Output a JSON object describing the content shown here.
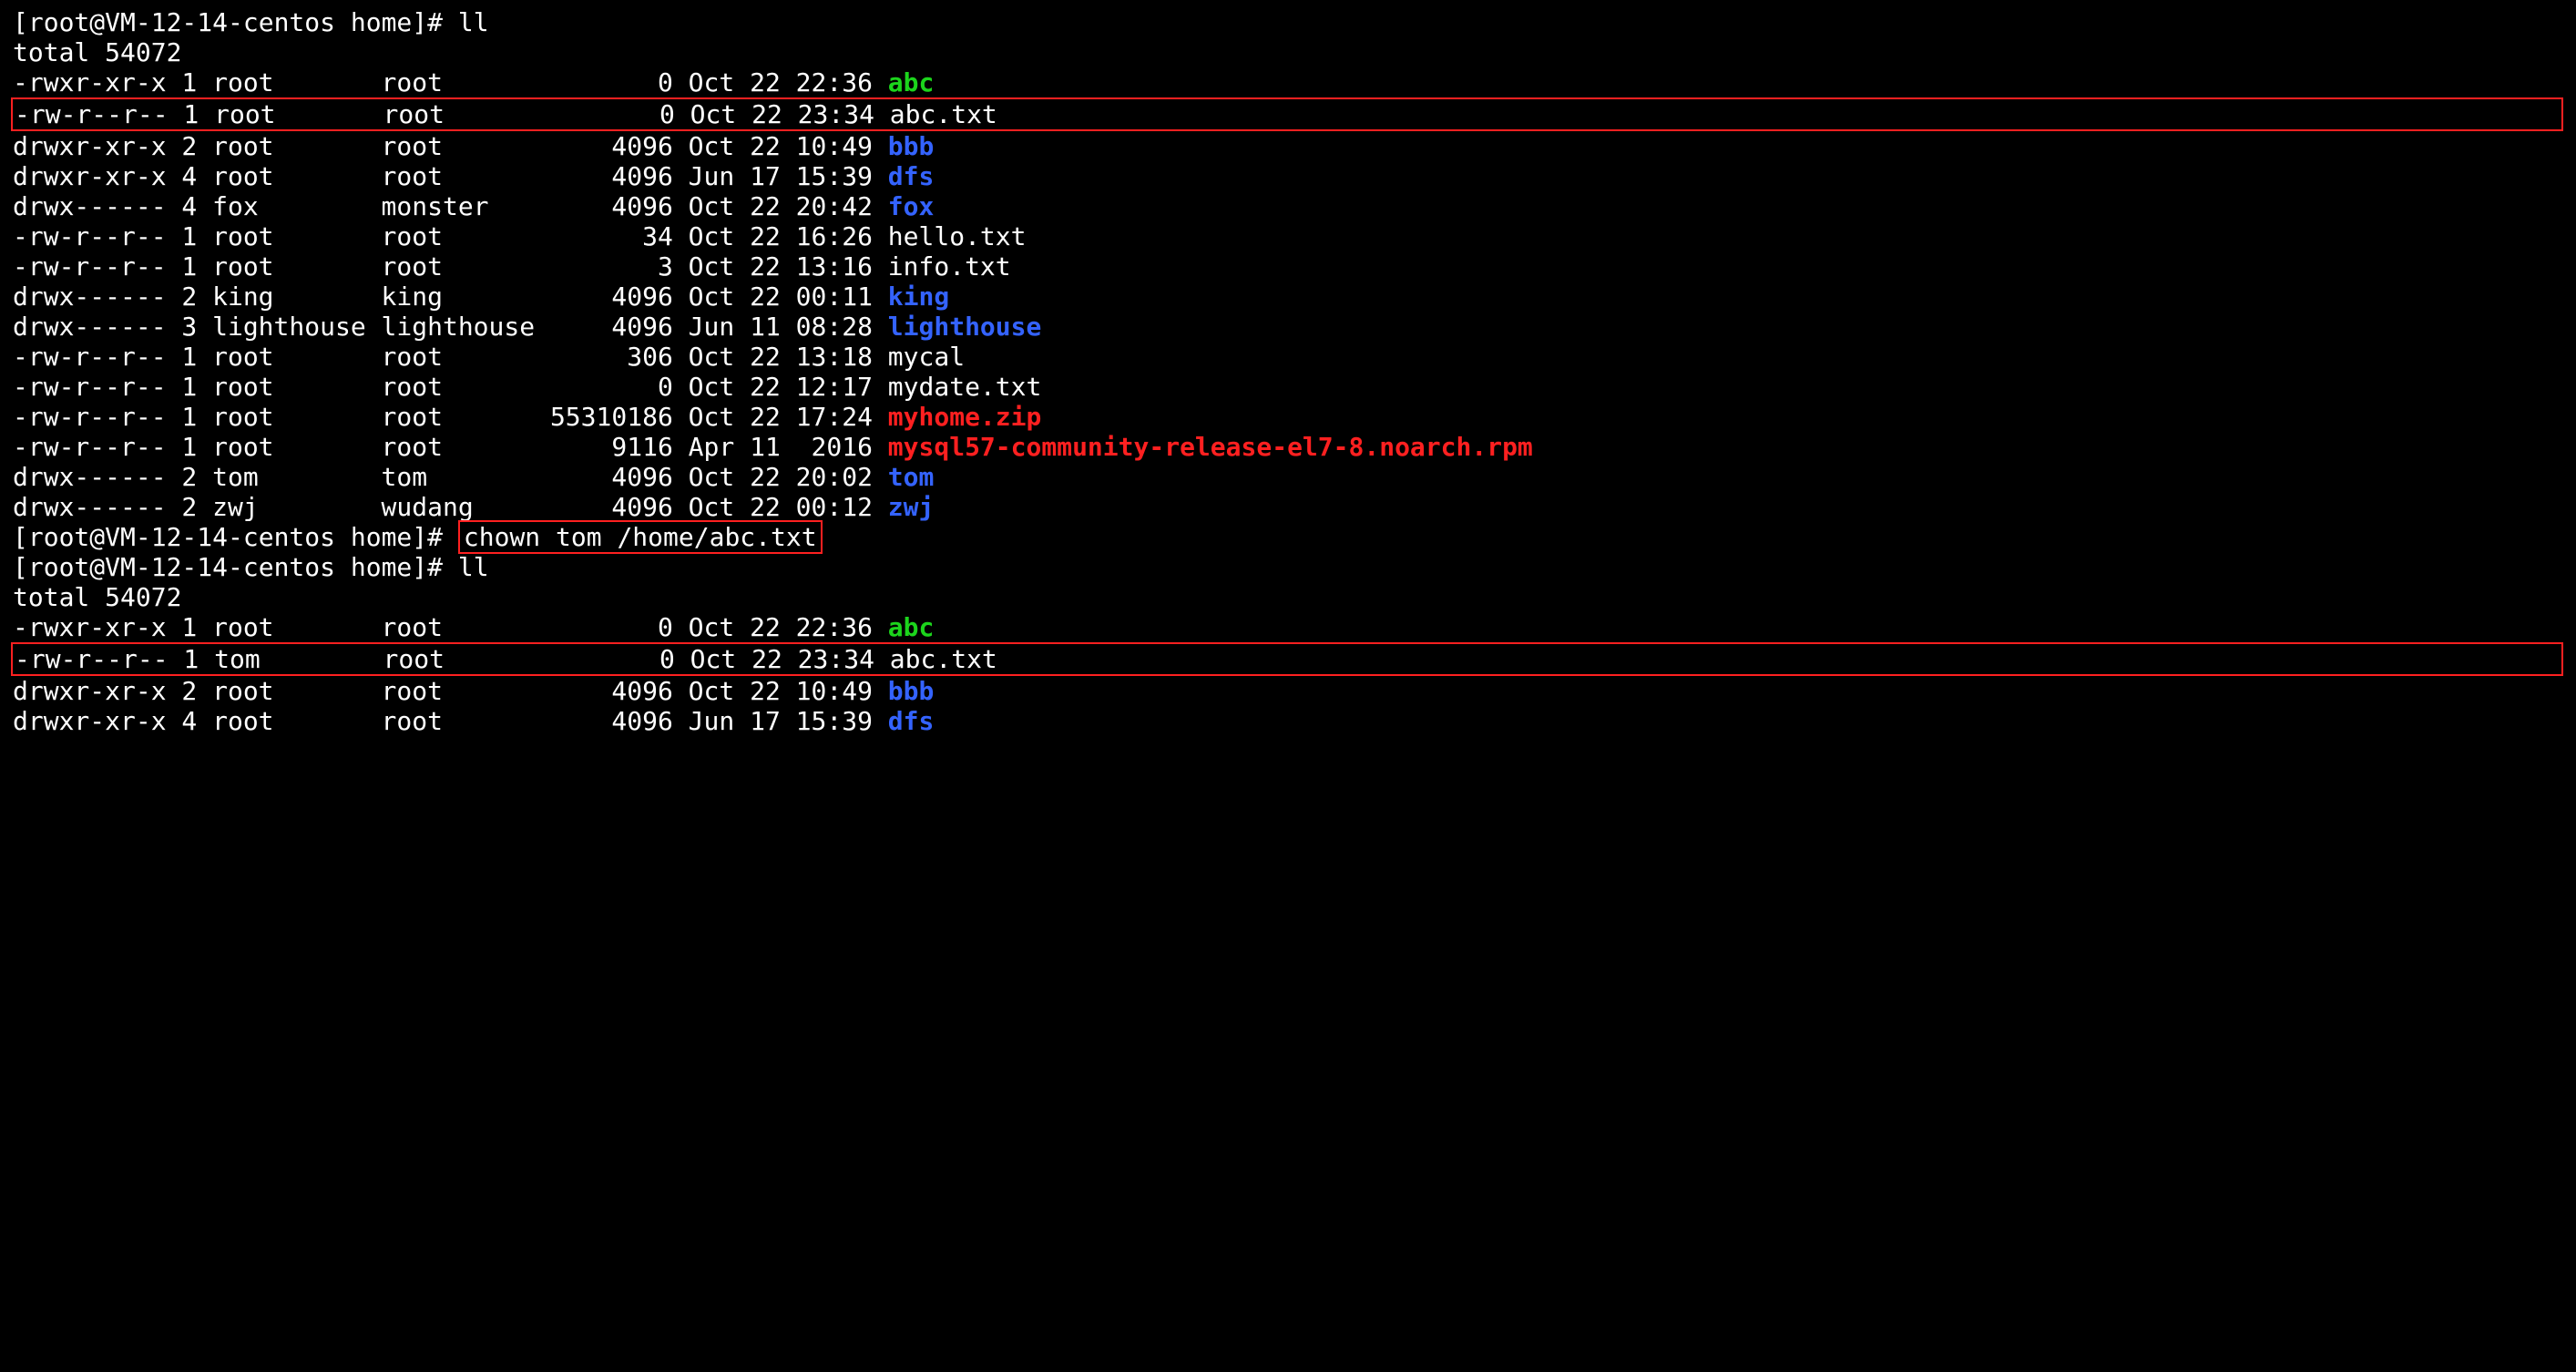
{
  "prompt": "[root@VM-12-14-centos home]# ",
  "cmd1": "ll",
  "total1": "total 54072",
  "files1": [
    {
      "perm": "-rwxr-xr-x",
      "links": "1",
      "owner": "root",
      "group": "root",
      "size": "0",
      "date": "Oct 22",
      "time": "22:36",
      "name": "abc",
      "class": "green",
      "boxed": false
    },
    {
      "perm": "-rw-r--r--",
      "links": "1",
      "owner": "root",
      "group": "root",
      "size": "0",
      "date": "Oct 22",
      "time": "23:34",
      "name": "abc.txt",
      "class": "white",
      "boxed": true
    },
    {
      "perm": "drwxr-xr-x",
      "links": "2",
      "owner": "root",
      "group": "root",
      "size": "4096",
      "date": "Oct 22",
      "time": "10:49",
      "name": "bbb",
      "class": "blue",
      "boxed": false
    },
    {
      "perm": "drwxr-xr-x",
      "links": "4",
      "owner": "root",
      "group": "root",
      "size": "4096",
      "date": "Jun 17",
      "time": "15:39",
      "name": "dfs",
      "class": "blue",
      "boxed": false
    },
    {
      "perm": "drwx------",
      "links": "4",
      "owner": "fox",
      "group": "monster",
      "size": "4096",
      "date": "Oct 22",
      "time": "20:42",
      "name": "fox",
      "class": "blue",
      "boxed": false
    },
    {
      "perm": "-rw-r--r--",
      "links": "1",
      "owner": "root",
      "group": "root",
      "size": "34",
      "date": "Oct 22",
      "time": "16:26",
      "name": "hello.txt",
      "class": "white",
      "boxed": false
    },
    {
      "perm": "-rw-r--r--",
      "links": "1",
      "owner": "root",
      "group": "root",
      "size": "3",
      "date": "Oct 22",
      "time": "13:16",
      "name": "info.txt",
      "class": "white",
      "boxed": false
    },
    {
      "perm": "drwx------",
      "links": "2",
      "owner": "king",
      "group": "king",
      "size": "4096",
      "date": "Oct 22",
      "time": "00:11",
      "name": "king",
      "class": "blue",
      "boxed": false
    },
    {
      "perm": "drwx------",
      "links": "3",
      "owner": "lighthouse",
      "group": "lighthouse",
      "size": "4096",
      "date": "Jun 11",
      "time": "08:28",
      "name": "lighthouse",
      "class": "blue",
      "boxed": false
    },
    {
      "perm": "-rw-r--r--",
      "links": "1",
      "owner": "root",
      "group": "root",
      "size": "306",
      "date": "Oct 22",
      "time": "13:18",
      "name": "mycal",
      "class": "white",
      "boxed": false
    },
    {
      "perm": "-rw-r--r--",
      "links": "1",
      "owner": "root",
      "group": "root",
      "size": "0",
      "date": "Oct 22",
      "time": "12:17",
      "name": "mydate.txt",
      "class": "white",
      "boxed": false
    },
    {
      "perm": "-rw-r--r--",
      "links": "1",
      "owner": "root",
      "group": "root",
      "size": "55310186",
      "date": "Oct 22",
      "time": "17:24",
      "name": "myhome.zip",
      "class": "red",
      "boxed": false
    },
    {
      "perm": "-rw-r--r--",
      "links": "1",
      "owner": "root",
      "group": "root",
      "size": "9116",
      "date": "Apr 11",
      "time": "2016",
      "name": "mysql57-community-release-el7-8.noarch.rpm",
      "class": "red",
      "boxed": false
    },
    {
      "perm": "drwx------",
      "links": "2",
      "owner": "tom",
      "group": "tom",
      "size": "4096",
      "date": "Oct 22",
      "time": "20:02",
      "name": "tom",
      "class": "blue",
      "boxed": false
    },
    {
      "perm": "drwx------",
      "links": "2",
      "owner": "zwj",
      "group": "wudang",
      "size": "4096",
      "date": "Oct 22",
      "time": "00:12",
      "name": "zwj",
      "class": "blue",
      "boxed": false
    }
  ],
  "cmd2": "chown tom /home/abc.txt",
  "cmd3": "ll",
  "total2": "total 54072",
  "files2": [
    {
      "perm": "-rwxr-xr-x",
      "links": "1",
      "owner": "root",
      "group": "root",
      "size": "0",
      "date": "Oct 22",
      "time": "22:36",
      "name": "abc",
      "class": "green",
      "boxed": false
    },
    {
      "perm": "-rw-r--r--",
      "links": "1",
      "owner": "tom",
      "group": "root",
      "size": "0",
      "date": "Oct 22",
      "time": "23:34",
      "name": "abc.txt",
      "class": "white",
      "boxed": true
    },
    {
      "perm": "drwxr-xr-x",
      "links": "2",
      "owner": "root",
      "group": "root",
      "size": "4096",
      "date": "Oct 22",
      "time": "10:49",
      "name": "bbb",
      "class": "blue",
      "boxed": false
    },
    {
      "perm": "drwxr-xr-x",
      "links": "4",
      "owner": "root",
      "group": "root",
      "size": "4096",
      "date": "Jun 17",
      "time": "15:39",
      "name": "dfs",
      "class": "blue",
      "boxed": false
    }
  ]
}
